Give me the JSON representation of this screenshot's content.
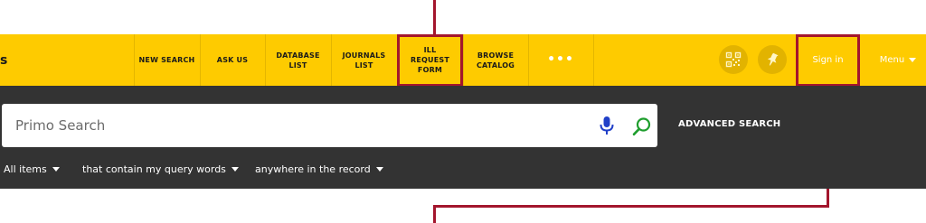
{
  "nav": {
    "logo_fragment": "s",
    "items": [
      {
        "label": "NEW SEARCH"
      },
      {
        "label": "ASK US"
      },
      {
        "label": "DATABASE LIST"
      },
      {
        "label": "JOURNALS LIST"
      },
      {
        "label": "ILL REQUEST FORM"
      },
      {
        "label": "BROWSE CATALOG"
      }
    ],
    "more": "•••",
    "sign_in": "Sign in",
    "menu": "Menu"
  },
  "search": {
    "placeholder": "Primo Search",
    "advanced": "ADVANCED SEARCH"
  },
  "filters": {
    "scope": "All items",
    "match": "that contain my query words",
    "field": "anywhere in the record"
  },
  "colors": {
    "nav_bg": "#fecb00",
    "search_bg": "#333333",
    "highlight": "#a3162d",
    "mic": "#2140c8",
    "search_icon": "#1f9e2e"
  }
}
